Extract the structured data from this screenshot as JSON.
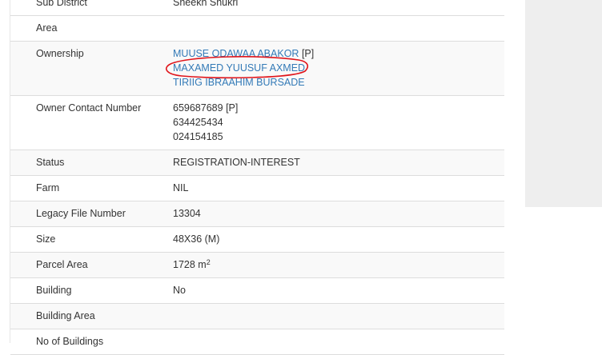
{
  "rows": [
    {
      "label": "Sub District",
      "value": "Sheekh Shukri"
    },
    {
      "label": "Area",
      "value": ""
    },
    {
      "label": "Ownership"
    },
    {
      "label": "Owner Contact Number"
    },
    {
      "label": "Status",
      "value": "REGISTRATION-INTEREST"
    },
    {
      "label": "Farm",
      "value": "NIL"
    },
    {
      "label": "Legacy File Number",
      "value": "13304"
    },
    {
      "label": "Size",
      "value": "48X36 (M)"
    },
    {
      "label": "Parcel Area",
      "value": "1728 m",
      "unit_sup": "2"
    },
    {
      "label": "Building",
      "value": "No"
    },
    {
      "label": "Building Area",
      "value": ""
    },
    {
      "label": "No of Buildings",
      "value": ""
    }
  ],
  "ownership": {
    "owners": [
      "MUUSE ODAWAA ABAKOR",
      "MAXAMED YUUSUF AXMED",
      "TIRIIG IBRAAHIM BURSADE"
    ],
    "primary_marker": "[P]"
  },
  "contacts": {
    "numbers": [
      "659687689",
      "634425434",
      "024154185"
    ],
    "primary_marker": "[P]"
  },
  "colors": {
    "link": "#337ab7",
    "annotation": "#e0151b",
    "row_stripe": "#f9f9f9",
    "side_panel": "#eeeeee"
  }
}
